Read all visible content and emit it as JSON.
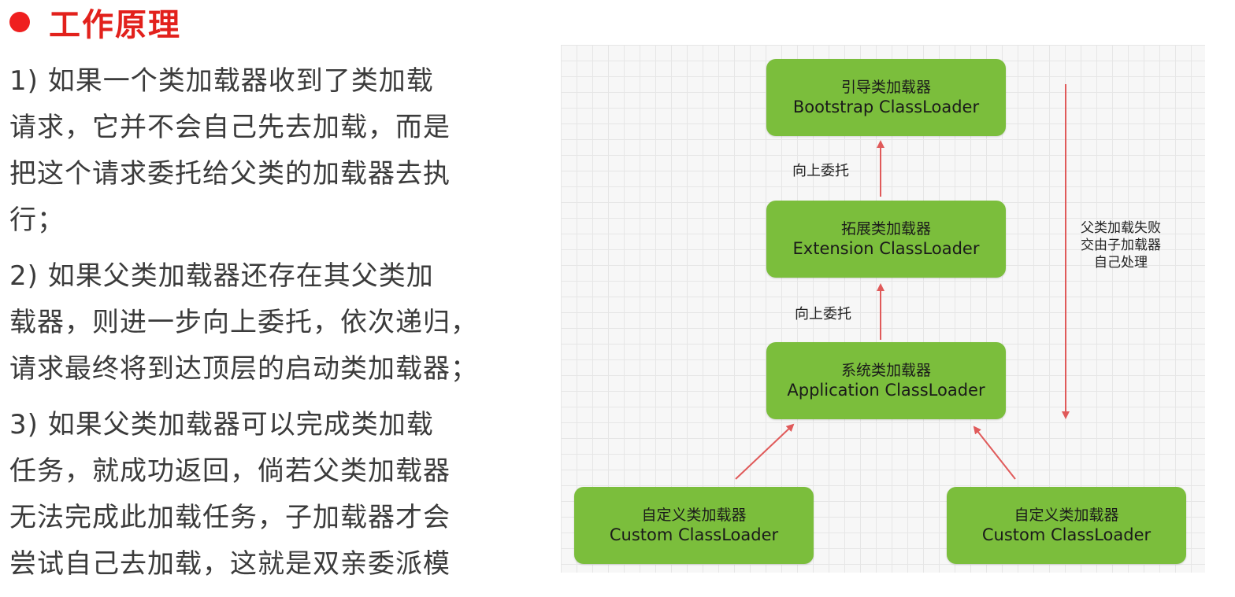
{
  "header": {
    "title": "工作原理"
  },
  "paragraphs": [
    {
      "lines": [
        "1) 如果一个类加载器收到了类加载",
        "请求，它并不会自己先去加载，而是",
        "把这个请求委托给父类的加载器去执",
        "行；"
      ]
    },
    {
      "lines": [
        "2) 如果父类加载器还存在其父类加",
        "载器，则进一步向上委托，依次递归，",
        "请求最终将到达顶层的启动类加载器；"
      ]
    },
    {
      "lines": [
        "3) 如果父类加载器可以完成类加载",
        "任务，就成功返回，倘若父类加载器",
        "无法完成此加载任务，子加载器才会",
        "尝试自己去加载，这就是双亲委派模"
      ]
    }
  ],
  "diagram": {
    "nodes": {
      "bootstrap": {
        "cn": "引导类加载器",
        "en": "Bootstrap ClassLoader"
      },
      "extension": {
        "cn": "拓展类加载器",
        "en": "Extension ClassLoader"
      },
      "application": {
        "cn": "系统类加载器",
        "en": "Application ClassLoader"
      },
      "custom_left": {
        "cn": "自定义类加载器",
        "en": "Custom ClassLoader"
      },
      "custom_right": {
        "cn": "自定义类加载器",
        "en": "Custom ClassLoader"
      }
    },
    "edge_labels": {
      "upper": "向上委托",
      "lower": "向上委托"
    },
    "side_note": [
      "父类加载失败",
      "交由子加载器",
      "自己处理"
    ],
    "colors": {
      "node_fill": "#7bbe3c",
      "arrow": "#e05a5a",
      "title": "#e2211c"
    }
  }
}
